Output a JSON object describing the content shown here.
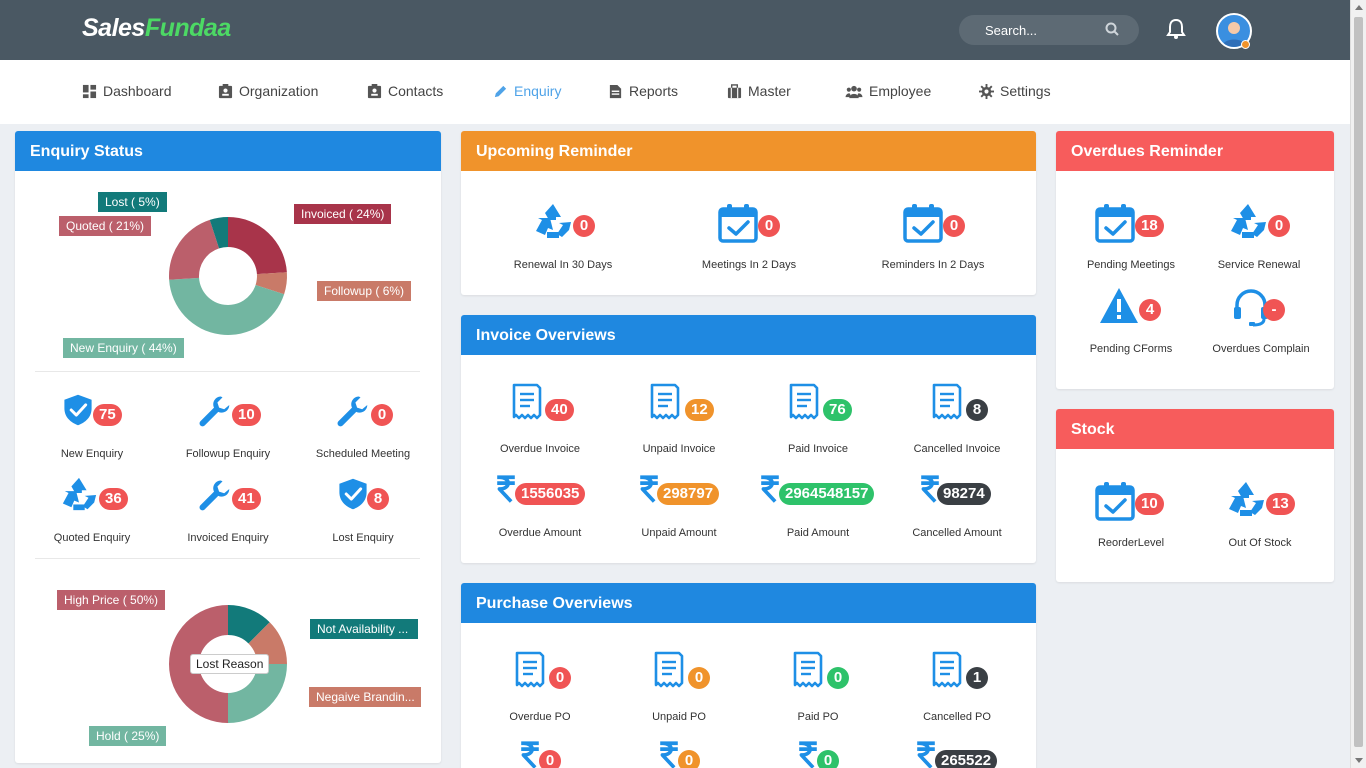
{
  "app": {
    "logo_part1": "Sales",
    "logo_part2": "Fundaa"
  },
  "search": {
    "placeholder": "Search..."
  },
  "nav": [
    {
      "label": "Dashboard",
      "icon": "dashboard-icon"
    },
    {
      "label": "Organization",
      "icon": "organization-icon"
    },
    {
      "label": "Contacts",
      "icon": "contacts-icon"
    },
    {
      "label": "Enquiry",
      "icon": "pencil-icon",
      "active": true
    },
    {
      "label": "Reports",
      "icon": "reports-icon"
    },
    {
      "label": "Master",
      "icon": "briefcase-icon"
    },
    {
      "label": "Employee",
      "icon": "employee-icon"
    },
    {
      "label": "Settings",
      "icon": "gear-icon"
    }
  ],
  "enquiry_status": {
    "title": "Enquiry Status",
    "donut_labels": {
      "lost": "Lost ( 5%)",
      "quoted": "Quoted ( 21%)",
      "invoiced": "Invoiced ( 24%)",
      "followup": "Followup ( 6%)",
      "new": "New Enquiry ( 44%)"
    },
    "stats": [
      {
        "label": "New Enquiry",
        "value": "75"
      },
      {
        "label": "Followup Enquiry",
        "value": "10"
      },
      {
        "label": "Scheduled Meeting",
        "value": "0"
      },
      {
        "label": "Quoted Enquiry",
        "value": "36"
      },
      {
        "label": "Invoiced Enquiry",
        "value": "41"
      },
      {
        "label": "Lost Enquiry",
        "value": "8"
      }
    ],
    "lost_reason": {
      "center": "Lost Reason",
      "high_price": "High Price ( 50%)",
      "not_availability": "Not Availability ...",
      "negative_branding": "Negaive Brandin...",
      "hold": "Hold ( 25%)"
    }
  },
  "chart_data": [
    {
      "type": "pie",
      "title": "",
      "categories": [
        "Invoiced",
        "Followup",
        "New Enquiry",
        "Quoted",
        "Lost"
      ],
      "values": [
        24,
        6,
        44,
        21,
        5
      ],
      "colors": [
        "#a8344a",
        "#c97a68",
        "#72b6a1",
        "#bb5f6b",
        "#127a7a"
      ]
    },
    {
      "type": "pie",
      "title": "Lost Reason",
      "categories": [
        "Not Availability",
        "Negaive Branding",
        "Hold",
        "High Price"
      ],
      "values": [
        12.5,
        12.5,
        25,
        50
      ],
      "colors": [
        "#127a7a",
        "#c97a68",
        "#72b6a1",
        "#bb5f6b"
      ]
    }
  ],
  "upcoming": {
    "title": "Upcoming Reminder",
    "items": [
      {
        "label": "Renewal In 30 Days",
        "value": "0",
        "icon": "recycle-icon"
      },
      {
        "label": "Meetings In 2 Days",
        "value": "0",
        "icon": "calendar-check-icon"
      },
      {
        "label": "Reminders In 2 Days",
        "value": "0",
        "icon": "calendar-check-icon"
      }
    ]
  },
  "invoice": {
    "title": "Invoice Overviews",
    "items": [
      {
        "label": "Overdue Invoice",
        "value": "40"
      },
      {
        "label": "Unpaid Invoice",
        "value": "12"
      },
      {
        "label": "Paid Invoice",
        "value": "76"
      },
      {
        "label": "Cancelled Invoice",
        "value": "8"
      }
    ],
    "amounts": [
      {
        "label": "Overdue Amount",
        "value": "1556035"
      },
      {
        "label": "Unpaid Amount",
        "value": "298797"
      },
      {
        "label": "Paid Amount",
        "value": "2964548157"
      },
      {
        "label": "Cancelled Amount",
        "value": "98274"
      }
    ]
  },
  "purchase": {
    "title": "Purchase Overviews",
    "items": [
      {
        "label": "Overdue PO",
        "value": "0"
      },
      {
        "label": "Unpaid PO",
        "value": "0"
      },
      {
        "label": "Paid PO",
        "value": "0"
      },
      {
        "label": "Cancelled PO",
        "value": "1"
      }
    ],
    "amounts": [
      {
        "value": "0"
      },
      {
        "value": "0"
      },
      {
        "value": "0"
      },
      {
        "value": "265522"
      }
    ]
  },
  "overdues": {
    "title": "Overdues Reminder",
    "items": [
      {
        "label": "Pending Meetings",
        "value": "18"
      },
      {
        "label": "Service Renewal",
        "value": "0"
      },
      {
        "label": "Pending CForms",
        "value": "4"
      },
      {
        "label": "Overdues Complain",
        "value": "-"
      }
    ]
  },
  "stock": {
    "title": "Stock",
    "items": [
      {
        "label": "ReorderLevel",
        "value": "10"
      },
      {
        "label": "Out Of Stock",
        "value": "13"
      }
    ]
  }
}
